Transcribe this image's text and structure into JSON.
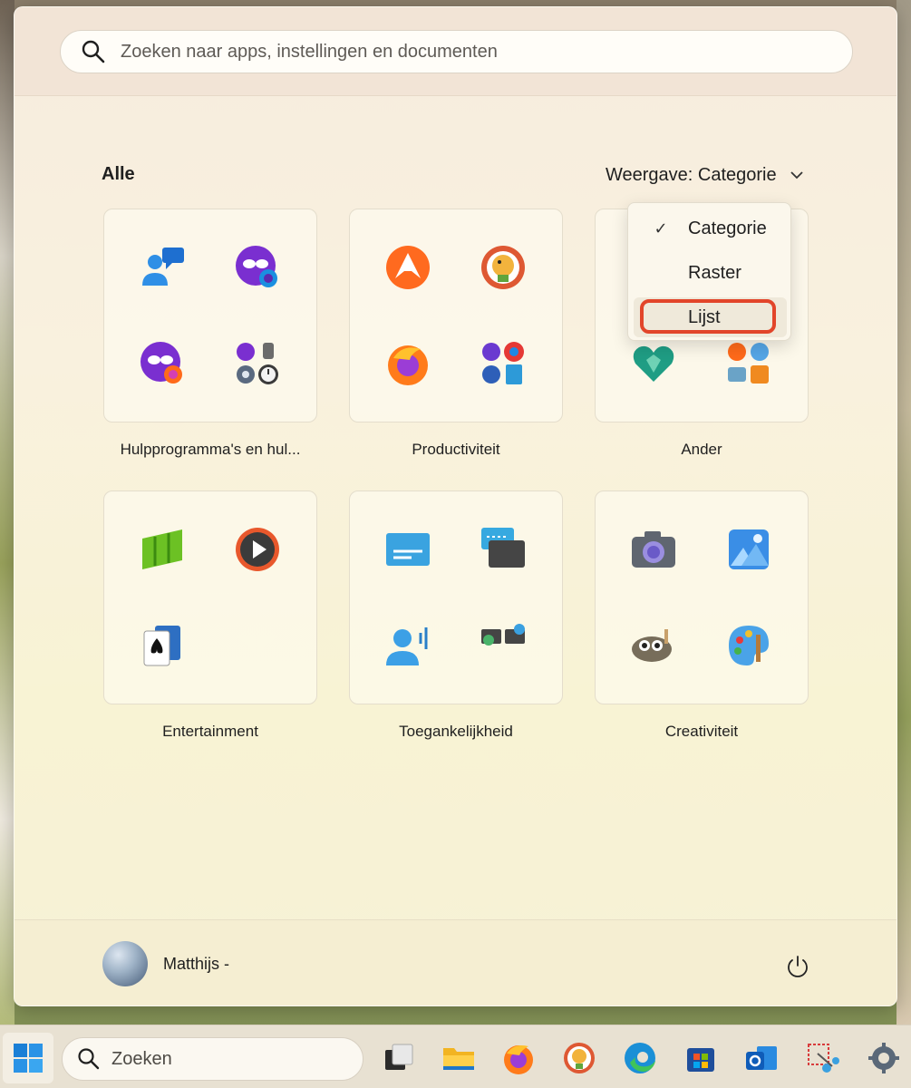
{
  "search": {
    "placeholder": "Zoeken naar apps, instellingen en documenten"
  },
  "section": {
    "title": "Alle",
    "view_label": "Weergave: Categorie"
  },
  "view_menu": {
    "items": [
      {
        "label": "Categorie",
        "checked": true
      },
      {
        "label": "Raster",
        "checked": false
      },
      {
        "label": "Lijst",
        "checked": false,
        "highlighted": true
      }
    ]
  },
  "categories": [
    {
      "label": "Hulpprogramma's en hul...",
      "apps": [
        "chat-people-icon",
        "incognito-mask-icon",
        "private-browsing-icon",
        "tools-cluster-icon"
      ]
    },
    {
      "label": "Productiviteit",
      "apps": [
        "avast-icon",
        "duckduckgo-icon",
        "firefox-icon",
        "browsers-cluster-icon"
      ]
    },
    {
      "label": "Ander",
      "apps": [
        "app-icon",
        "app-icon",
        "heart-shield-icon",
        "utilities-cluster-icon"
      ]
    },
    {
      "label": "Entertainment",
      "apps": [
        "green-blocks-icon",
        "media-player-icon",
        "solitaire-icon"
      ]
    },
    {
      "label": "Toegankelijkheid",
      "apps": [
        "narrator-icon",
        "captions-icon",
        "voice-access-icon",
        "magnifier-icon"
      ]
    },
    {
      "label": "Creativiteit",
      "apps": [
        "camera-icon",
        "photos-icon",
        "gimp-icon",
        "paint-icon"
      ]
    }
  ],
  "user": {
    "name": "Matthijs -"
  },
  "taskbar": {
    "search_placeholder": "Zoeken",
    "icons": [
      "task-view-icon",
      "file-explorer-icon",
      "firefox-icon",
      "duckduckgo-icon",
      "edge-icon",
      "store-icon",
      "outlook-icon",
      "snipping-tool-icon",
      "settings-icon"
    ]
  },
  "colors": {
    "highlight_ring": "#e2452a",
    "accent": "#0067c0"
  }
}
